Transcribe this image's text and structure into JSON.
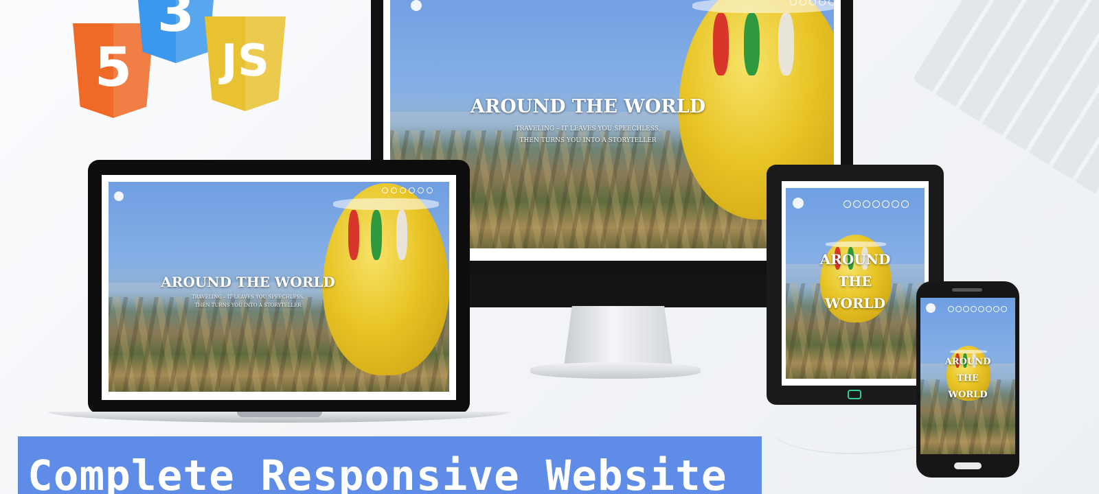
{
  "logos": [
    {
      "name": "html5",
      "glyph": "5",
      "color": "#ef6a27"
    },
    {
      "name": "css3",
      "glyph": "3",
      "color": "#3c98ec"
    },
    {
      "name": "javascript",
      "glyph": "JS",
      "color": "#e8c232"
    }
  ],
  "site": {
    "title": "AROUND THE WORLD",
    "title_stacked": [
      "AROUND",
      "THE",
      "WORLD"
    ],
    "subtitle_line1": "TRAVELING – IT LEAVES YOU SPEECHLESS,",
    "subtitle_line2": "THEN TURNS YOU INTO A STORYTELLER"
  },
  "banner": {
    "text": "Complete Responsive Website",
    "color": "#5e8ce6"
  },
  "colors": {
    "balloon_yellow": "#e8c425",
    "tablet_home_accent": "#2fcf9a"
  }
}
